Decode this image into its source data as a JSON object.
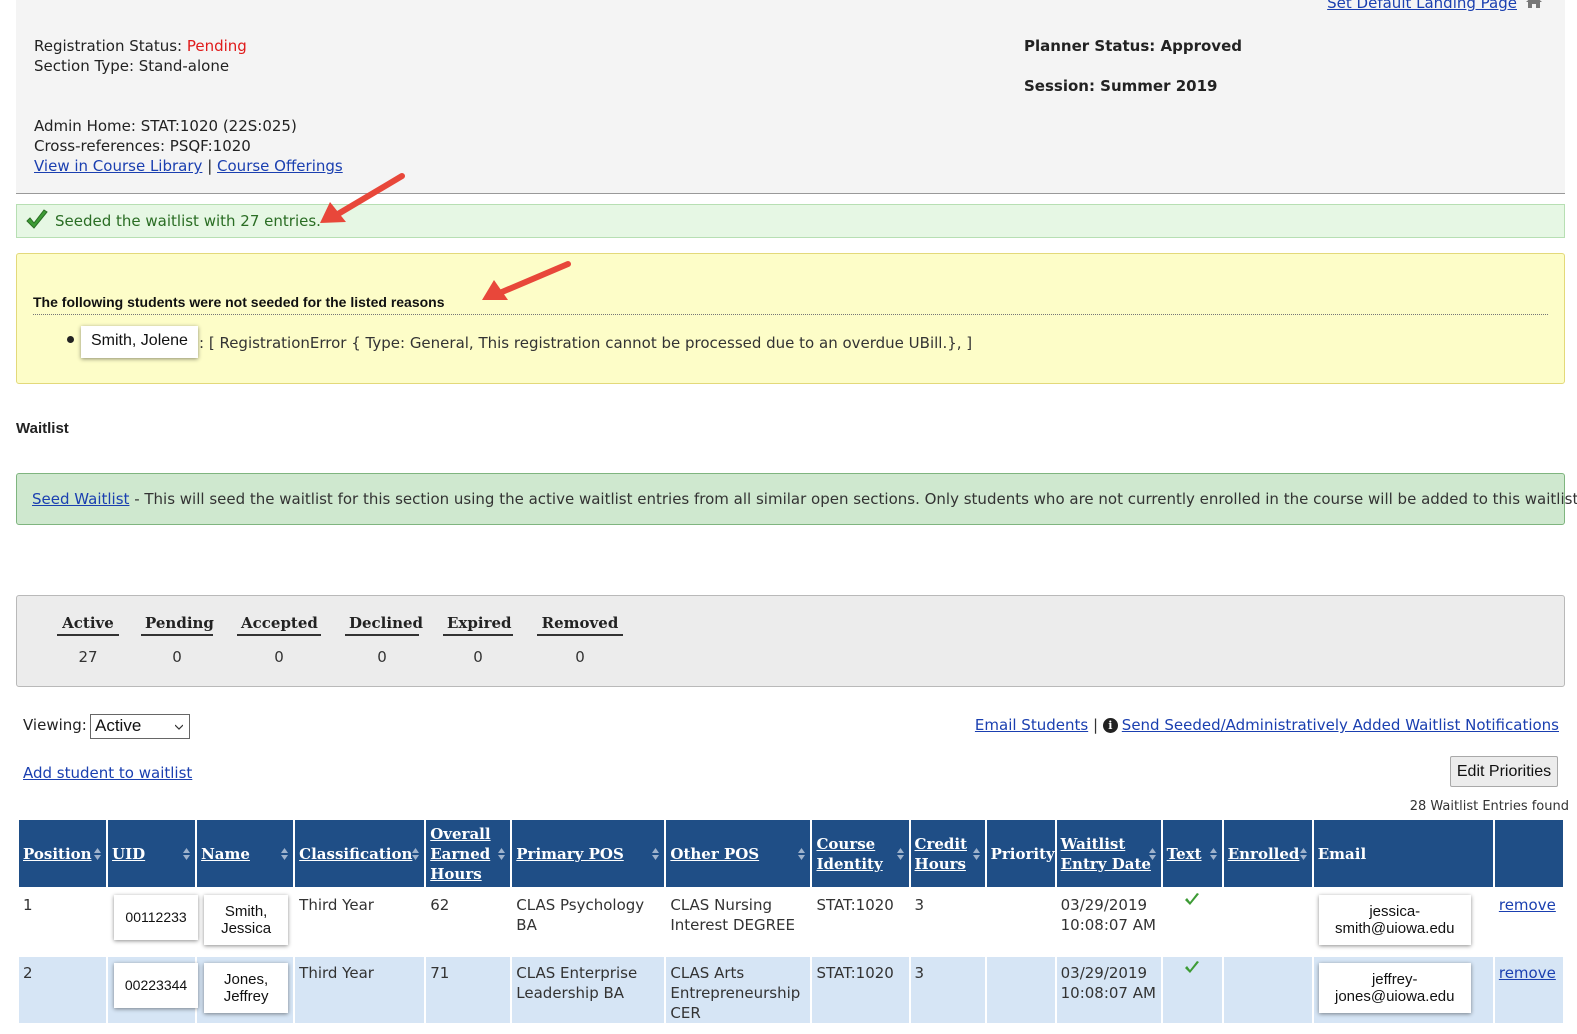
{
  "header": {
    "default_landing_link": "Set Default Landing Page",
    "registration_status_label": "Registration Status:",
    "registration_status_value": "Pending",
    "section_type": "Section Type: Stand-alone",
    "planner_status": "Planner Status: Approved",
    "session": "Session: Summer 2019",
    "admin_home": "Admin Home: STAT:1020 (22S:025)",
    "cross_references": "Cross-references: PSQF:1020",
    "view_library_link": "View in Course Library",
    "separator": "|",
    "course_offerings_link": "Course Offerings"
  },
  "success_message": "Seeded the waitlist with 27 entries.",
  "warning": {
    "title": "The following students were not seeded for the listed reasons",
    "items": [
      {
        "name": "Smith, Jolene",
        "reason": ": [ RegistrationError { Type: General, This registration cannot be processed due to an overdue UBill.}, ]"
      }
    ]
  },
  "waitlist_heading": "Waitlist",
  "seed": {
    "link": "Seed Waitlist",
    "description": " - This will seed the waitlist for this section using the active waitlist entries from all similar open sections. Only students who are not currently enrolled in the course will be added to this waitlist."
  },
  "counts": [
    {
      "label": "Active",
      "value": "27"
    },
    {
      "label": "Pending",
      "value": "0"
    },
    {
      "label": "Accepted",
      "value": "0"
    },
    {
      "label": "Declined",
      "value": "0"
    },
    {
      "label": "Expired",
      "value": "0"
    },
    {
      "label": "Removed",
      "value": "0"
    }
  ],
  "viewing": {
    "label": "Viewing:",
    "selected": "Active"
  },
  "links": {
    "email_students": "Email Students",
    "separator": "|",
    "send_notifications": "Send Seeded/Administratively Added Waitlist Notifications",
    "add_student": "Add student to waitlist"
  },
  "edit_priorities_button": "Edit Priorities",
  "entries_found": "28 Waitlist Entries found",
  "table": {
    "headers": {
      "position": "Position",
      "uid": "UID",
      "name": "Name",
      "classification": "Classification",
      "overall_earned_hours": "Overall Earned Hours",
      "primary_pos": "Primary POS",
      "other_pos": "Other POS",
      "course_identity": "Course Identity",
      "credit_hours": "Credit Hours",
      "priority": "Priority",
      "waitlist_entry_date": "Waitlist Entry Date",
      "text": "Text",
      "enrolled": "Enrolled",
      "email": "Email"
    },
    "rows": [
      {
        "position": "1",
        "uid": "00112233",
        "name": "Smith, Jessica",
        "classification": "Third Year",
        "hours": "62",
        "primary_pos": "CLAS Psychology BA",
        "other_pos": "CLAS Nursing Interest DEGREE",
        "course_identity": "STAT:1020",
        "credit_hours": "3",
        "priority": "",
        "entry_date": "03/29/2019 10:08:07 AM",
        "text_check": "check-icon",
        "enrolled": "",
        "email": "jessica-smith@uiowa.edu",
        "remove": "remove"
      },
      {
        "position": "2",
        "uid": "00223344",
        "name": "Jones, Jeffrey",
        "classification": "Third Year",
        "hours": "71",
        "primary_pos": "CLAS Enterprise Leadership BA",
        "other_pos": "CLAS Arts Entrepreneurship CER",
        "course_identity": "STAT:1020",
        "credit_hours": "3",
        "priority": "",
        "entry_date": "03/29/2019 10:08:07 AM",
        "text_check": "check-icon",
        "enrolled": "",
        "email": "jeffrey-jones@uiowa.edu",
        "remove": "remove"
      }
    ]
  },
  "colors": {
    "header_blue": "#1f4e86",
    "pending_red": "#e01b1b",
    "success_green": "#2a6d24",
    "arrow_red": "#e8473a"
  }
}
